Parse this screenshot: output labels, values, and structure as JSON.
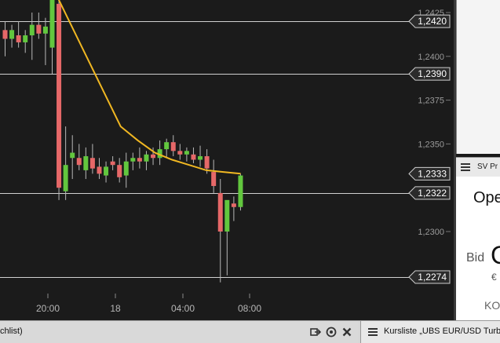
{
  "chart_data": {
    "type": "candlestick",
    "y_ticks": [
      "1,2425",
      "1,2400",
      "1,2375",
      "1,2350",
      "1,2300"
    ],
    "x_ticks": [
      "20:00",
      "18",
      "04:00",
      "08:00"
    ],
    "horizontal_lines": [
      "1,2420",
      "1,2390",
      "1,2322",
      "1,2274"
    ],
    "price_tags": [
      "1,2420",
      "1,2390",
      "1,2333",
      "1,2322",
      "1,2274"
    ],
    "candles": [
      {
        "o": 1.2415,
        "h": 1.242,
        "l": 1.24,
        "c": 1.241
      },
      {
        "o": 1.241,
        "h": 1.2418,
        "l": 1.2405,
        "c": 1.2415
      },
      {
        "o": 1.2412,
        "h": 1.242,
        "l": 1.2405,
        "c": 1.2408
      },
      {
        "o": 1.2408,
        "h": 1.2415,
        "l": 1.2402,
        "c": 1.2412
      },
      {
        "o": 1.2412,
        "h": 1.2425,
        "l": 1.2398,
        "c": 1.2418
      },
      {
        "o": 1.2418,
        "h": 1.2425,
        "l": 1.241,
        "c": 1.2413
      },
      {
        "o": 1.2413,
        "h": 1.2422,
        "l": 1.2395,
        "c": 1.2417
      },
      {
        "o": 1.2405,
        "h": 1.244,
        "l": 1.239,
        "c": 1.2435
      },
      {
        "o": 1.243,
        "h": 1.2435,
        "l": 1.2318,
        "c": 1.2325
      },
      {
        "o": 1.2323,
        "h": 1.236,
        "l": 1.2318,
        "c": 1.2338
      },
      {
        "o": 1.2342,
        "h": 1.2355,
        "l": 1.233,
        "c": 1.2345
      },
      {
        "o": 1.2342,
        "h": 1.235,
        "l": 1.2335,
        "c": 1.2338
      },
      {
        "o": 1.2335,
        "h": 1.2348,
        "l": 1.233,
        "c": 1.2343
      },
      {
        "o": 1.2342,
        "h": 1.235,
        "l": 1.2333,
        "c": 1.2336
      },
      {
        "o": 1.2337,
        "h": 1.2342,
        "l": 1.233,
        "c": 1.2333
      },
      {
        "o": 1.2332,
        "h": 1.234,
        "l": 1.2328,
        "c": 1.2337
      },
      {
        "o": 1.234,
        "h": 1.2343,
        "l": 1.2335,
        "c": 1.2338
      },
      {
        "o": 1.2338,
        "h": 1.2342,
        "l": 1.2328,
        "c": 1.2331
      },
      {
        "o": 1.2332,
        "h": 1.2345,
        "l": 1.2325,
        "c": 1.234
      },
      {
        "o": 1.234,
        "h": 1.2345,
        "l": 1.2335,
        "c": 1.2342
      },
      {
        "o": 1.2342,
        "h": 1.2348,
        "l": 1.2336,
        "c": 1.234
      },
      {
        "o": 1.234,
        "h": 1.2346,
        "l": 1.2335,
        "c": 1.2344
      },
      {
        "o": 1.2344,
        "h": 1.2348,
        "l": 1.2338,
        "c": 1.2342
      },
      {
        "o": 1.2342,
        "h": 1.2352,
        "l": 1.2338,
        "c": 1.2347
      },
      {
        "o": 1.2347,
        "h": 1.2353,
        "l": 1.2342,
        "c": 1.2351
      },
      {
        "o": 1.2351,
        "h": 1.2355,
        "l": 1.2343,
        "c": 1.2346
      },
      {
        "o": 1.2346,
        "h": 1.235,
        "l": 1.2341,
        "c": 1.2344
      },
      {
        "o": 1.2344,
        "h": 1.2348,
        "l": 1.234,
        "c": 1.2346
      },
      {
        "o": 1.2344,
        "h": 1.2348,
        "l": 1.2339,
        "c": 1.2341
      },
      {
        "o": 1.2341,
        "h": 1.2349,
        "l": 1.2337,
        "c": 1.2343
      },
      {
        "o": 1.2343,
        "h": 1.2347,
        "l": 1.2333,
        "c": 1.2336
      },
      {
        "o": 1.2334,
        "h": 1.2341,
        "l": 1.2322,
        "c": 1.2326
      },
      {
        "o": 1.2322,
        "h": 1.233,
        "l": 1.2271,
        "c": 1.23
      },
      {
        "o": 1.23,
        "h": 1.2317,
        "l": 1.2275,
        "c": 1.2318
      },
      {
        "o": 1.2316,
        "h": 1.232,
        "l": 1.2306,
        "c": 1.2314
      },
      {
        "o": 1.2314,
        "h": 1.2333,
        "l": 1.2312,
        "c": 1.2332
      }
    ],
    "ma_line": [
      1.244,
      1.242,
      1.24,
      1.238,
      1.236,
      1.2352,
      1.2345,
      1.2341,
      1.2338,
      1.2335,
      1.2334,
      1.2333
    ],
    "y_range": [
      1.2265,
      1.243
    ]
  },
  "colors": {
    "up": "#62c73e",
    "down": "#e66868",
    "ma": "#f0b722",
    "grid": "#d0d0d0"
  },
  "side_panel": {
    "title": "SV Pr",
    "heading": "Ope",
    "bid_label": "Bid",
    "bid_value": "C",
    "currency": "€",
    "ko_label": "KO"
  },
  "bottom_bar": {
    "left_text": "chlist)",
    "right_text": "Kursliste „UBS EUR/USD Turb"
  }
}
